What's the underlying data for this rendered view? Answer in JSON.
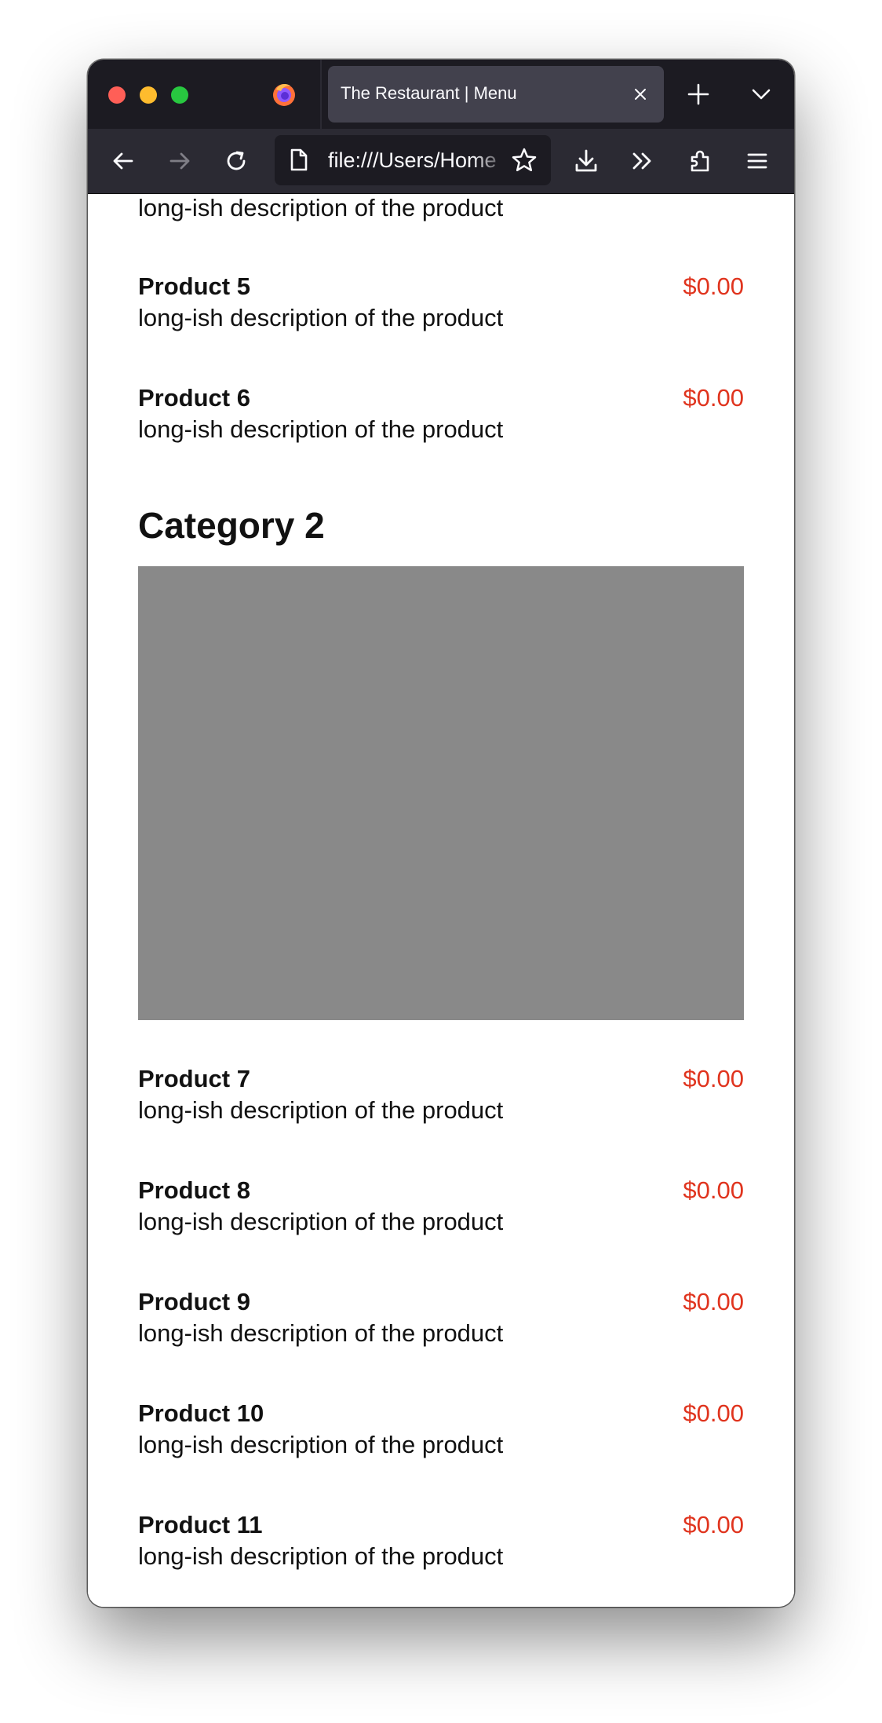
{
  "browser": {
    "tab_title": "The Restaurant | Menu",
    "url": "file:///Users/Home",
    "icons": {
      "close": "close-icon",
      "new_tab": "plus-icon",
      "tab_list": "chevron-down-icon",
      "back": "back-arrow-icon",
      "forward": "forward-arrow-icon",
      "reload": "reload-icon",
      "page": "page-icon",
      "bookmark": "star-icon",
      "downloads": "download-icon",
      "overflow": "double-chevron-icon",
      "extensions": "puzzle-icon",
      "menu": "hamburger-icon"
    }
  },
  "page": {
    "cut_off_item_description": "long-ish description of the product",
    "category1_tail": [
      {
        "name": "Product 5",
        "description": "long-ish description of the product",
        "price": "$0.00"
      },
      {
        "name": "Product 6",
        "description": "long-ish description of the product",
        "price": "$0.00"
      }
    ],
    "category2": {
      "title": "Category 2",
      "image_color": "#898989",
      "products": [
        {
          "name": "Product 7",
          "description": "long-ish description of the product",
          "price": "$0.00"
        },
        {
          "name": "Product 8",
          "description": "long-ish description of the product",
          "price": "$0.00"
        },
        {
          "name": "Product 9",
          "description": "long-ish description of the product",
          "price": "$0.00"
        },
        {
          "name": "Product 10",
          "description": "long-ish description of the product",
          "price": "$0.00"
        },
        {
          "name": "Product 11",
          "description": "long-ish description of the product",
          "price": "$0.00"
        }
      ]
    },
    "colors": {
      "price": "#e0341e",
      "text": "#111111",
      "tabbar": "#1c1b22",
      "navbar": "#2b2a33"
    }
  }
}
